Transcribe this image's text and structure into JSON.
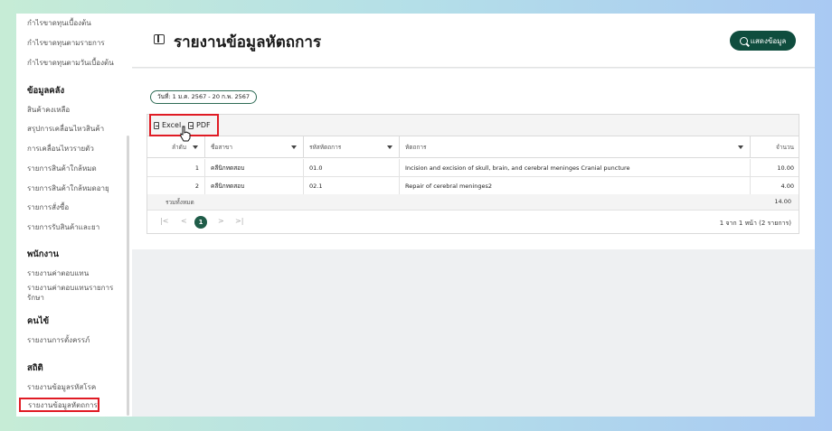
{
  "sidebar": {
    "top_items": [
      "กำไรขาดทุนเบื้องต้น",
      "กำไรขาดทุนตามรายการ",
      "กำไรขาดทุนตามวันเบื้องต้น"
    ],
    "sections": [
      {
        "title": "ข้อมูลคลัง",
        "items": [
          "สินค้าคงเหลือ",
          "สรุปการเคลื่อนไหวสินค้า",
          "การเคลื่อนไหวรายตัว",
          "รายการสินค้าใกล้หมด",
          "รายการสินค้าใกล้หมดอายุ",
          "รายการสั่งซื้อ",
          "รายการรับสินค้าและยา"
        ]
      },
      {
        "title": "พนักงาน",
        "items": [
          "รายงานค่าตอบแทน",
          "รายงานค่าตอบแทนรายการรักษา"
        ]
      },
      {
        "title": "คนไข้",
        "items": [
          "รายงานการตั้งครรภ์"
        ]
      },
      {
        "title": "สถิติ",
        "items": [
          "รายงานข้อมูลรหัสโรค",
          "รายงานข้อมูลหัตถการ"
        ]
      }
    ]
  },
  "header": {
    "title": "รายงานข้อมูลหัตถการ",
    "show_button": "แสดงข้อมูล"
  },
  "filter": {
    "date_range": "วันที่: 1 ม.ค. 2567 - 20 ก.พ. 2567"
  },
  "toolbar": {
    "excel": "Excel",
    "pdf": "PDF"
  },
  "table": {
    "columns": [
      "ลำดับ",
      "ชื่อสาขา",
      "รหัสหัตถการ",
      "หัตถการ",
      "จำนวน"
    ],
    "rows": [
      [
        "1",
        "คลีนิกทดสอบ",
        "01.0",
        "Incision and excision of skull, brain, and cerebral meninges Cranial puncture",
        "10.00"
      ],
      [
        "2",
        "คลีนิกทดสอบ",
        "02.1",
        "Repair of cerebral meninges2",
        "4.00"
      ]
    ],
    "total_label": "รวมทั้งหมด",
    "total_value": "14.00"
  },
  "pager": {
    "first": "|<",
    "prev": "<",
    "current": "1",
    "next": ">",
    "last": ">|",
    "info": "1 จาก 1 หน้า (2 รายการ)"
  },
  "colors": {
    "primary": "#0f4d3e",
    "highlight": "#e01b24"
  }
}
